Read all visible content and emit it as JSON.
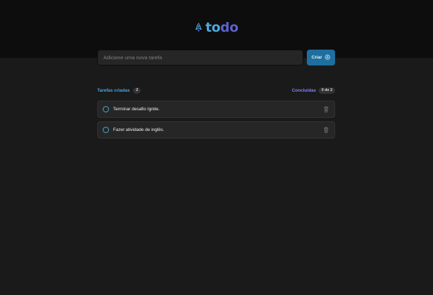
{
  "header": {
    "logo_part1": "to",
    "logo_part2": "do",
    "logo_icon": "rocket-icon"
  },
  "new_task": {
    "placeholder": "Adicione uma nova tarefa",
    "value": "",
    "create_label": "Criar",
    "create_icon": "plus-circle-icon"
  },
  "summary": {
    "created_label": "Tarefas criadas",
    "created_count": "2",
    "done_label": "Concluídas",
    "done_count": "0 de 2"
  },
  "tasks": [
    {
      "text": "Terminar desafio Ignite.",
      "completed": false
    },
    {
      "text": "Fazer atividade de inglês.",
      "completed": false
    }
  ],
  "colors": {
    "header_bg": "#0d0d0d",
    "page_bg": "#1a1a1a",
    "blue": "#4ea8de",
    "purple": "#8284fa",
    "button": "#1e6f9f",
    "card": "#262626"
  }
}
